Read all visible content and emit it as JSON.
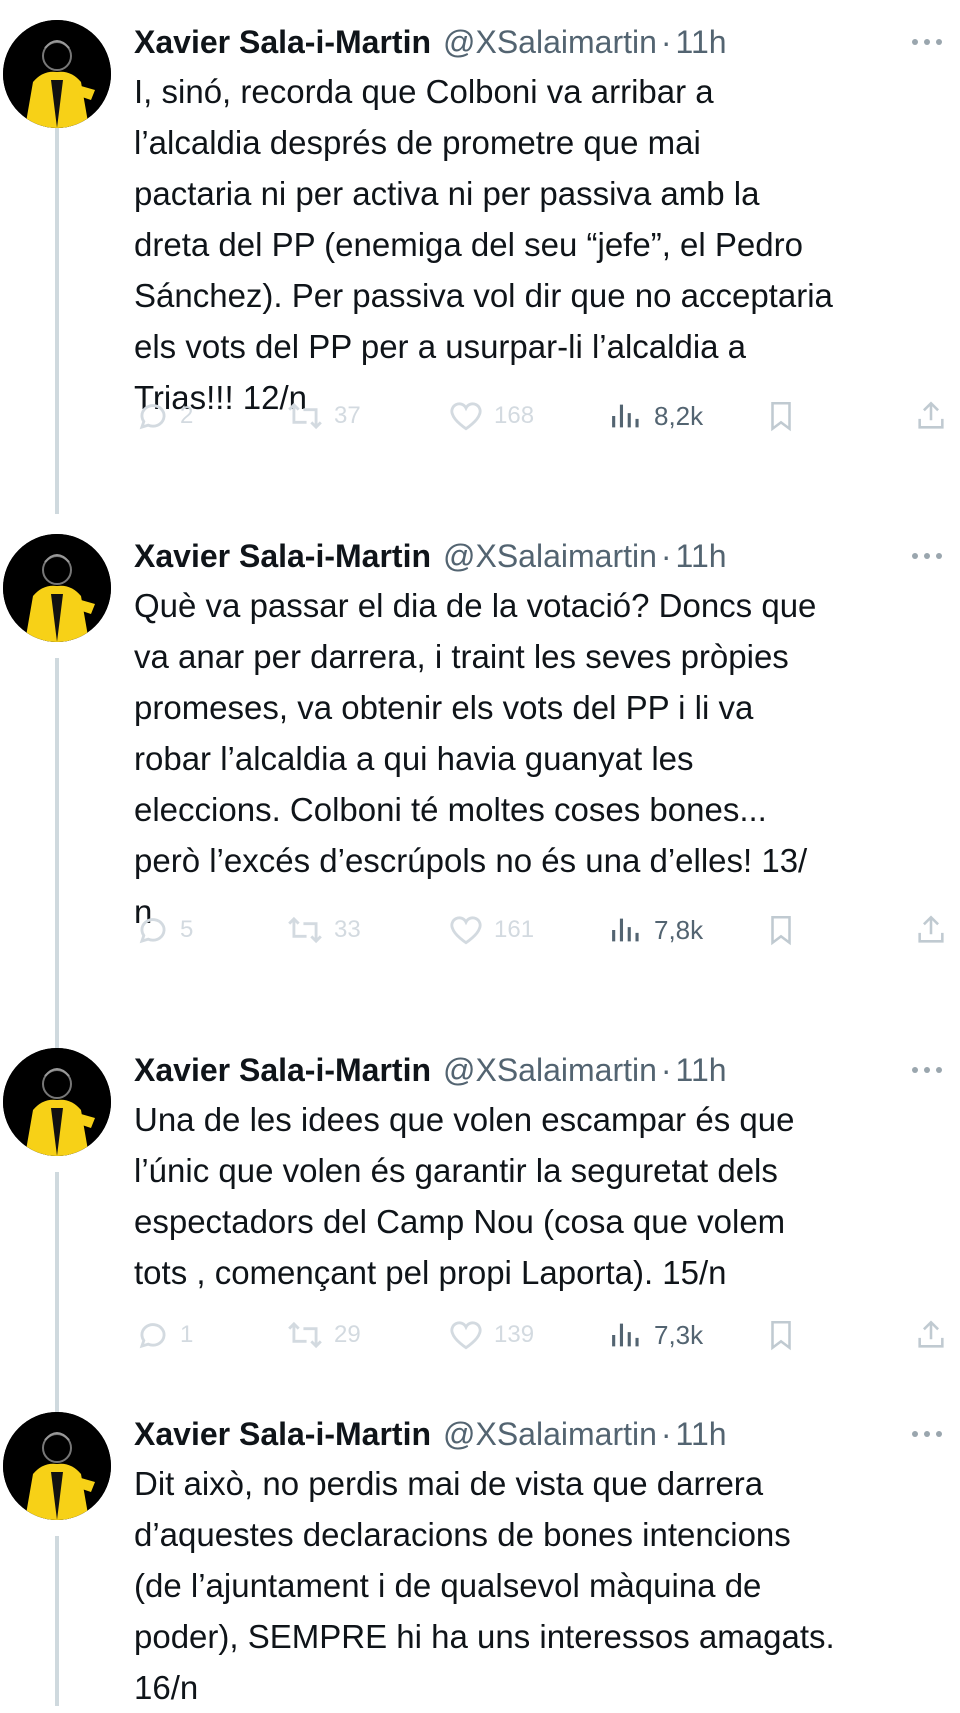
{
  "tweets": [
    {
      "author": "Xavier Sala-i-Martin",
      "handle": "@XSalaimartin",
      "sep": "·",
      "time": "11h",
      "lines": [
        "I, sinó, recorda que Colboni va arribar a",
        "l’alcaldia després de prometre que mai",
        "pactaria ni per activa ni per passiva amb la",
        "dreta del PP (enemiga del seu “jefe”, el Pedro",
        "Sánchez). Per passiva vol dir que no acceptaria",
        "els vots del PP per a usurpar-li l’alcaldia a",
        "Trias!!! 12/n"
      ],
      "replies": "2",
      "retweets": "37",
      "likes": "168",
      "views": "8,2k"
    },
    {
      "author": "Xavier Sala-i-Martin",
      "handle": "@XSalaimartin",
      "sep": "·",
      "time": "11h",
      "lines": [
        "Què va passar el dia de la votació? Doncs que",
        "va anar per darrera, i traint les seves pròpies",
        "promeses, va obtenir els vots del PP i li va",
        "robar l’alcaldia a qui havia guanyat les",
        "eleccions. Colboni té moltes coses bones...",
        "però l’excés d’escrúpols no és una d’elles! 13/",
        "n"
      ],
      "replies": "5",
      "retweets": "33",
      "likes": "161",
      "views": "7,8k"
    },
    {
      "author": "Xavier Sala-i-Martin",
      "handle": "@XSalaimartin",
      "sep": "·",
      "time": "11h",
      "lines": [
        "Una de les idees que volen escampar és que",
        "l’únic que volen és garantir la seguretat dels",
        "espectadors del Camp Nou (cosa que volem",
        "tots , començant pel propi Laporta). 15/n"
      ],
      "replies": "1",
      "retweets": "29",
      "likes": "139",
      "views": "7,3k"
    },
    {
      "author": "Xavier Sala-i-Martin",
      "handle": "@XSalaimartin",
      "sep": "·",
      "time": "11h",
      "lines": [
        "Dit això, no perdis mai de vista que darrera",
        "d’aquestes declaracions de bones intencions",
        "(de l’ajuntament i de qualsevol màquina de",
        "poder), SEMPRE hi ha uns interessos amagats.",
        "16/n"
      ]
    }
  ],
  "icons": {
    "reply": "reply-icon",
    "retweet": "retweet-icon",
    "like": "heart-icon",
    "views": "views-icon",
    "bookmark": "bookmark-icon",
    "share": "share-icon",
    "more": "more-icon"
  },
  "colors": {
    "name": "#0f1419",
    "secondary": "#536471",
    "faded": "#d3dae0",
    "thread_line": "#cfd9de",
    "avatar_yellow": "#f7d117"
  }
}
